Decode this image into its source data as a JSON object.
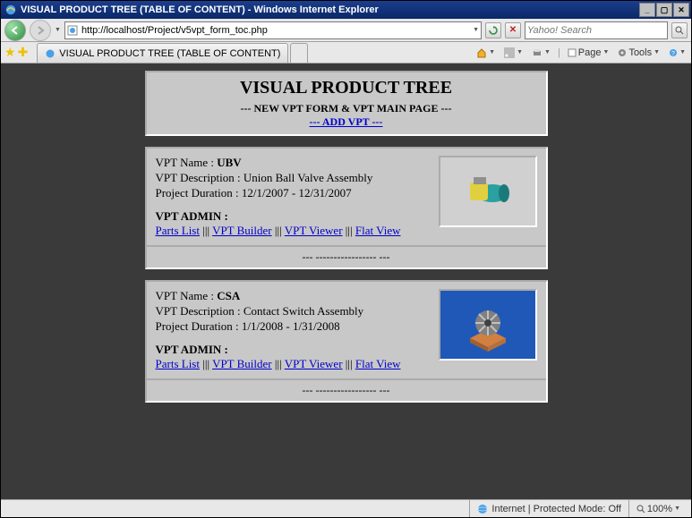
{
  "window": {
    "title": "VISUAL PRODUCT TREE (TABLE OF CONTENT) - Windows Internet Explorer"
  },
  "address": {
    "url": "http://localhost/Project/v5vpt_form_toc.php"
  },
  "search": {
    "placeholder": "Yahoo! Search"
  },
  "tab": {
    "title": "VISUAL PRODUCT TREE (TABLE OF CONTENT)"
  },
  "commandbar": {
    "page_label": "Page",
    "tools_label": "Tools"
  },
  "header": {
    "title": "VISUAL PRODUCT TREE",
    "subtitle": "--- NEW VPT FORM & VPT MAIN PAGE ---",
    "add_link": "--- ADD VPT ---"
  },
  "labels": {
    "vpt_name": "VPT Name : ",
    "vpt_desc": "VPT Description : ",
    "duration": "Project Duration : ",
    "admin": "VPT ADMIN :",
    "parts_list": "Parts List",
    "vpt_builder": "VPT Builder",
    "vpt_viewer": "VPT Viewer",
    "flat_view": "Flat View",
    "link_sep": " ||| ",
    "footer": "--- ----------------- ---"
  },
  "items": [
    {
      "name": "UBV",
      "desc": "Union Ball Valve Assembly",
      "duration": "12/1/2007 - 12/31/2007",
      "thumb_style": "bg-gray"
    },
    {
      "name": "CSA",
      "desc": "Contact Switch Assembly",
      "duration": "1/1/2008 - 1/31/2008",
      "thumb_style": "bg-blue"
    }
  ],
  "status": {
    "zone": "Internet | Protected Mode: Off",
    "zoom": "100%"
  }
}
